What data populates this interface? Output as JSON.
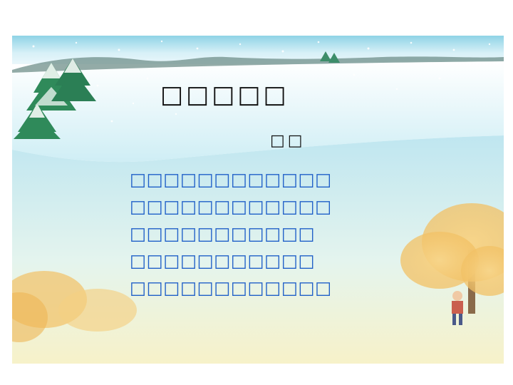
{
  "slide": {
    "title": "□□□□□",
    "author": "□□",
    "lines": [
      "□□□□□□□□□□□□",
      "□□□□□□□□□□□□",
      "□□□□□□□□□□□",
      "□□□□□□□□□□□",
      "□□□□□□□□□□□□"
    ]
  },
  "colors": {
    "title": "#111111",
    "author": "#111111",
    "lines": "#1f5fc8",
    "sky": "#c9ecf6",
    "snow": "#f4fbfd",
    "ground": "#eef3c7",
    "autumn_foliage": "#f3c36a",
    "tree_green": "#2f8a5a"
  }
}
